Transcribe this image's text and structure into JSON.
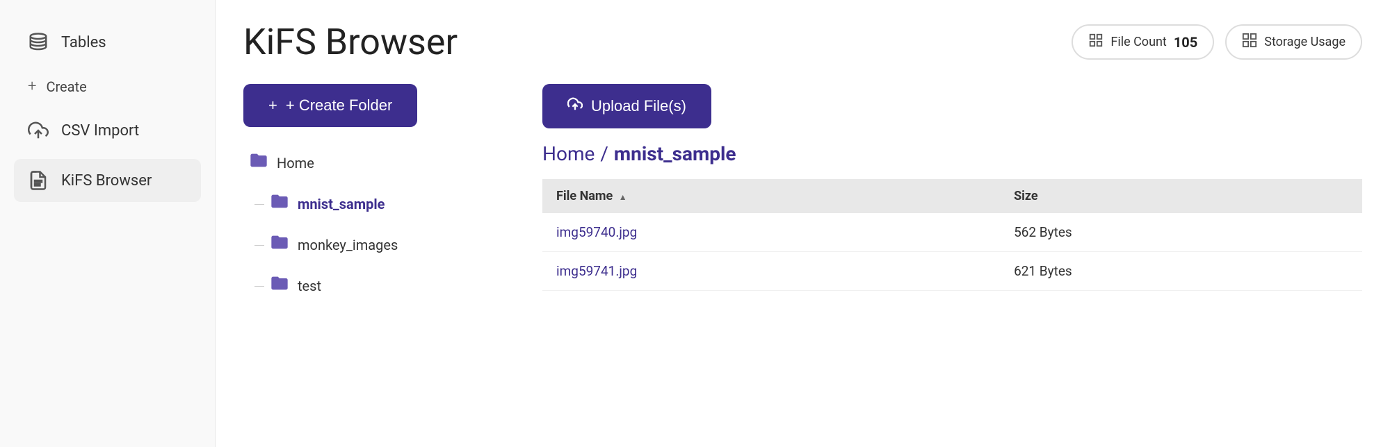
{
  "sidebar": {
    "items": [
      {
        "id": "tables",
        "label": "Tables",
        "icon": "tables"
      },
      {
        "id": "create",
        "label": "Create",
        "icon": "plus"
      },
      {
        "id": "csv-import",
        "label": "CSV Import",
        "icon": "upload"
      },
      {
        "id": "kifs-browser",
        "label": "KiFS Browser",
        "icon": "files",
        "active": true
      }
    ]
  },
  "header": {
    "title": "KiFS Browser",
    "stats": {
      "file_count_label": "File Count",
      "file_count_value": "105",
      "storage_label": "Storage Usage"
    }
  },
  "left_panel": {
    "create_folder_label": "+ Create Folder",
    "folders": [
      {
        "id": "home",
        "label": "Home",
        "level": "root"
      },
      {
        "id": "mnist_sample",
        "label": "mnist_sample",
        "level": "child",
        "active": true
      },
      {
        "id": "monkey_images",
        "label": "monkey_images",
        "level": "child"
      },
      {
        "id": "test",
        "label": "test",
        "level": "child"
      }
    ]
  },
  "right_panel": {
    "upload_label": "Upload File(s)",
    "breadcrumb": {
      "home": "Home",
      "separator": "/",
      "current": "mnist_sample"
    },
    "table": {
      "columns": [
        {
          "id": "name",
          "label": "File Name",
          "sortable": true
        },
        {
          "id": "size",
          "label": "Size"
        }
      ],
      "rows": [
        {
          "name": "img59740.jpg",
          "size": "562 Bytes"
        },
        {
          "name": "img59741.jpg",
          "size": "621 Bytes"
        }
      ]
    }
  }
}
